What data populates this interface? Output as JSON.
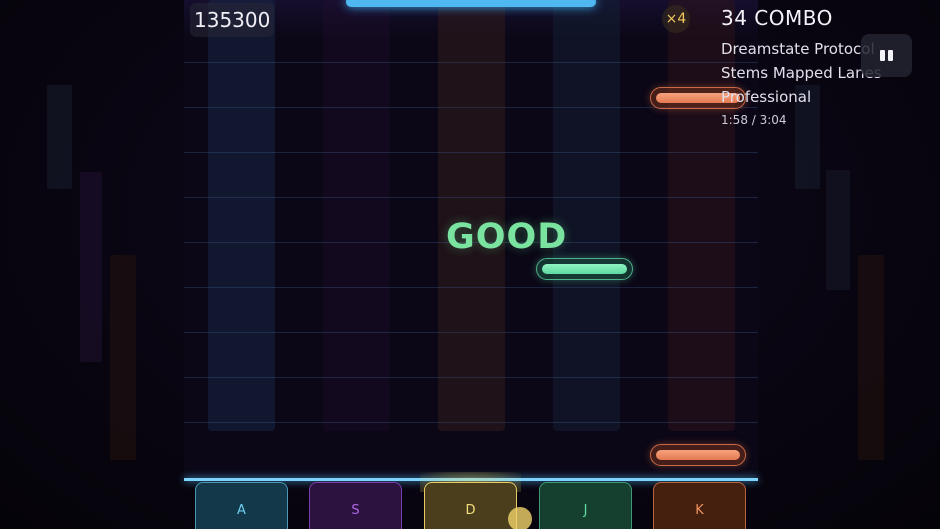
{
  "hud": {
    "score": "135300",
    "multiplier": "×4",
    "combo": "34 COMBO",
    "song_title": "Dreamstate Protocol",
    "chart_name": "Stems Mapped Lanes",
    "difficulty": "Professional",
    "time": "1:58 / 3:04"
  },
  "judgement": "GOOD",
  "keys": [
    {
      "label": "A",
      "color": "#5ec3ea"
    },
    {
      "label": "S",
      "color": "#a24ee0"
    },
    {
      "label": "D",
      "color": "#f1d36a"
    },
    {
      "label": "J",
      "color": "#59d89e"
    },
    {
      "label": "K",
      "color": "#ec8a5d"
    }
  ],
  "icons": {
    "pause": "pause-icon"
  }
}
